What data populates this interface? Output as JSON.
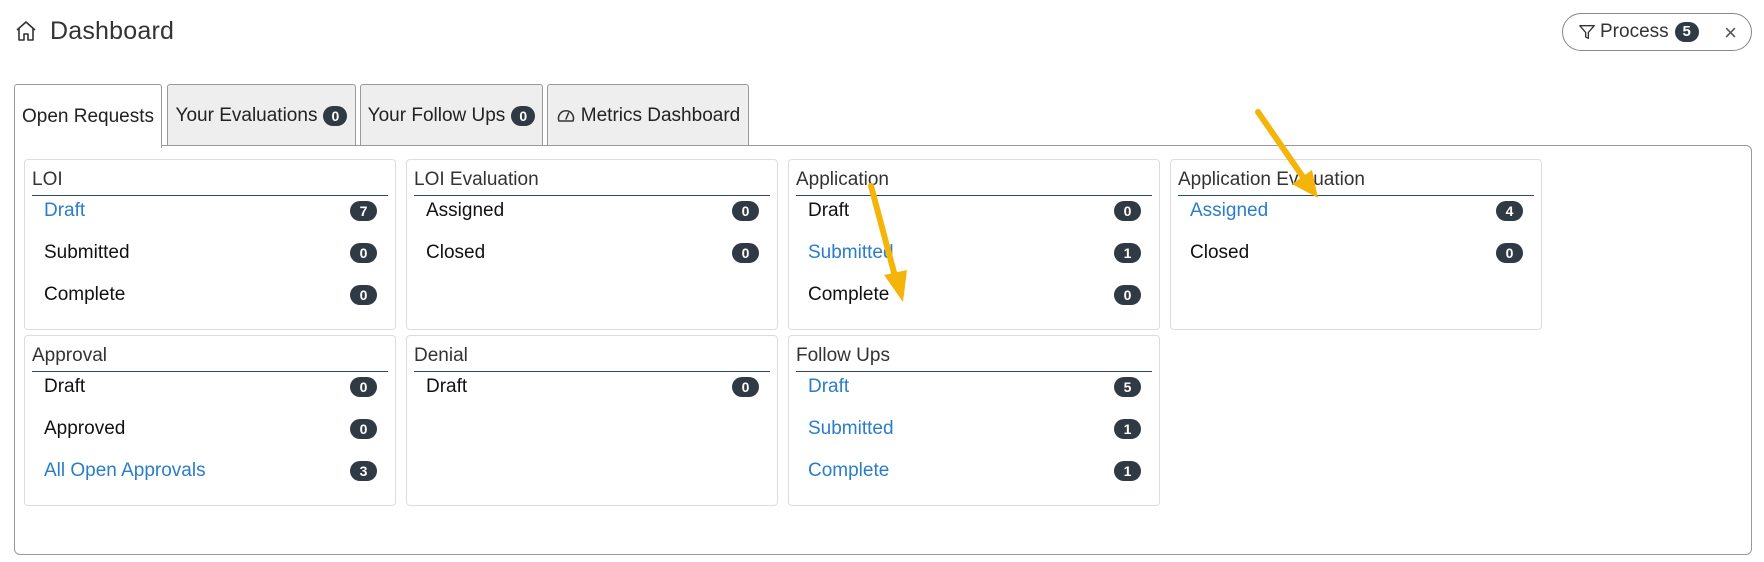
{
  "header": {
    "title": "Dashboard"
  },
  "filter_chip": {
    "label": "Process",
    "count": "5",
    "close": "×"
  },
  "tabs": [
    {
      "label": "Open Requests",
      "badge": null
    },
    {
      "label": "Your Evaluations",
      "badge": "0"
    },
    {
      "label": "Your Follow Ups",
      "badge": "0"
    },
    {
      "label": "Metrics Dashboard",
      "badge": null
    }
  ],
  "cards": {
    "loi": {
      "title": "LOI",
      "rows": [
        {
          "label": "Draft",
          "count": "7"
        },
        {
          "label": "Submitted",
          "count": "0"
        },
        {
          "label": "Complete",
          "count": "0"
        }
      ]
    },
    "loi_evaluation": {
      "title": "LOI Evaluation",
      "rows": [
        {
          "label": "Assigned",
          "count": "0"
        },
        {
          "label": "Closed",
          "count": "0"
        }
      ]
    },
    "application": {
      "title": "Application",
      "rows": [
        {
          "label": "Draft",
          "count": "0"
        },
        {
          "label": "Submitted",
          "count": "1"
        },
        {
          "label": "Complete",
          "count": "0"
        }
      ]
    },
    "application_evaluation": {
      "title": "Application Evaluation",
      "rows": [
        {
          "label": "Assigned",
          "count": "4"
        },
        {
          "label": "Closed",
          "count": "0"
        }
      ]
    },
    "approval": {
      "title": "Approval",
      "rows": [
        {
          "label": "Draft",
          "count": "0"
        },
        {
          "label": "Approved",
          "count": "0"
        },
        {
          "label": "All Open Approvals",
          "count": "3"
        }
      ]
    },
    "denial": {
      "title": "Denial",
      "rows": [
        {
          "label": "Draft",
          "count": "0"
        }
      ]
    },
    "follow_ups": {
      "title": "Follow Ups",
      "rows": [
        {
          "label": "Draft",
          "count": "5"
        },
        {
          "label": "Submitted",
          "count": "1"
        },
        {
          "label": "Complete",
          "count": "1"
        }
      ]
    }
  },
  "colors": {
    "link": "#2a7dc9",
    "badge": "#2f3a45",
    "arrow": "#f5b40a"
  }
}
